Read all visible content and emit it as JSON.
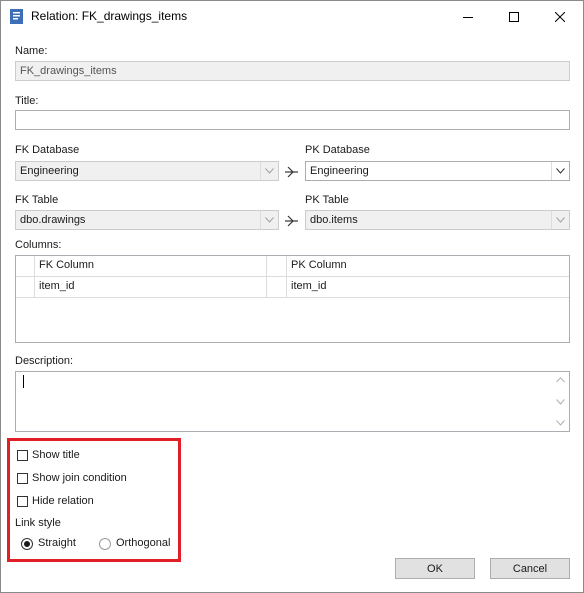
{
  "window": {
    "title": "Relation: FK_drawings_items",
    "icon": "document-icon",
    "controls": [
      "minimize-icon",
      "maximize-icon",
      "close-icon"
    ]
  },
  "form": {
    "name_label": "Name:",
    "name_value": "FK_drawings_items",
    "title_label": "Title:",
    "title_value": "",
    "fk_database_label": "FK Database",
    "fk_database_value": "Engineering",
    "pk_database_label": "PK Database",
    "pk_database_value": "Engineering",
    "fk_table_label": "FK Table",
    "fk_table_value": "dbo.drawings",
    "pk_table_label": "PK Table",
    "pk_table_value": "dbo.items",
    "columns_label": "Columns:",
    "columns_headers": [
      "FK Column",
      "PK Column"
    ],
    "columns_rows": [
      [
        "item_id",
        "item_id"
      ]
    ],
    "description_label": "Description:",
    "description_value": ""
  },
  "options": {
    "show_title": {
      "label": "Show title",
      "checked": false
    },
    "show_join_condition": {
      "label": "Show join condition",
      "checked": false
    },
    "hide_relation": {
      "label": "Hide relation",
      "checked": false
    },
    "link_style_label": "Link style",
    "link_styles": [
      {
        "label": "Straight",
        "selected": true
      },
      {
        "label": "Orthogonal",
        "selected": false
      }
    ],
    "highlight_color": "#e01f26"
  },
  "buttons": {
    "ok": "OK",
    "cancel": "Cancel"
  }
}
